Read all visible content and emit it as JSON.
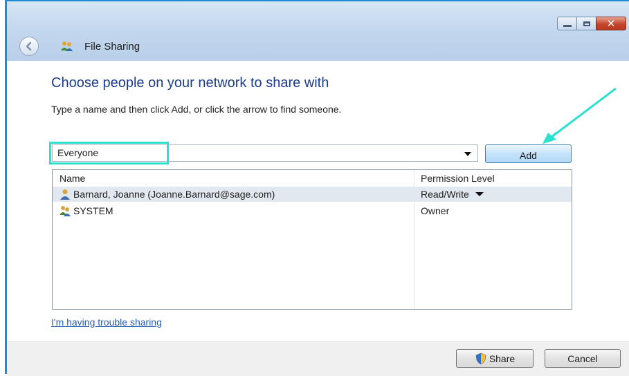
{
  "window": {
    "title": "File Sharing",
    "caption": {
      "minimize_icon": "minimize-icon",
      "maximize_icon": "maximize-icon",
      "close_icon": "close-icon"
    }
  },
  "main": {
    "heading": "Choose people on your network to share with",
    "instruction": "Type a name and then click Add, or click the arrow to find someone.",
    "name_input": {
      "value": "Everyone"
    },
    "add_label": "Add"
  },
  "list": {
    "columns": [
      "Name",
      "Permission Level"
    ],
    "rows": [
      {
        "name": "Barnard, Joanne (Joanne.Barnard@sage.com)",
        "permission": "Read/Write",
        "icon": "user-icon",
        "selected": true,
        "has_dropdown": true
      },
      {
        "name": "SYSTEM",
        "permission": "Owner",
        "icon": "group-icon",
        "selected": false,
        "has_dropdown": false
      }
    ]
  },
  "help_link": "I'm having trouble sharing",
  "footer": {
    "share_label": "Share",
    "cancel_label": "Cancel"
  },
  "colors": {
    "heading": "#1a3c8c",
    "link": "#2a5db0",
    "annotation": "#2ee0d0",
    "title_bar": "#c4d8ee"
  }
}
